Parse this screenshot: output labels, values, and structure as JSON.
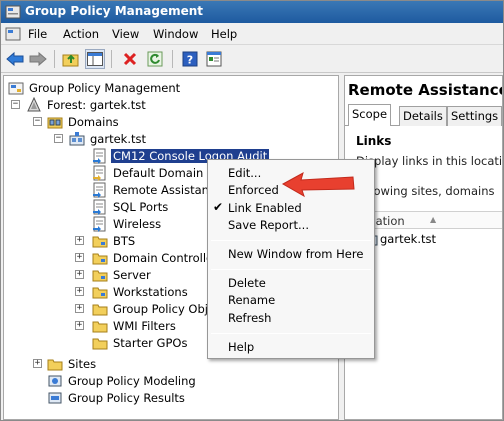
{
  "window": {
    "title": "Group Policy Management"
  },
  "menubar": {
    "items": [
      "File",
      "Action",
      "View",
      "Window",
      "Help"
    ]
  },
  "toolbar": {
    "buttons": [
      "back-icon",
      "forward-icon",
      "up-folder-icon",
      "show-hide-tree-icon",
      "delete-icon",
      "refresh-icon",
      "help-icon",
      "properties-icon"
    ]
  },
  "tree": {
    "root": "Group Policy Management",
    "forest": "Forest: gartek.tst",
    "domains": "Domains",
    "domain": "gartek.tst",
    "gpo_links": [
      "CM12 Console Logon Audit",
      "Default Domain Pol",
      "Remote Assistance",
      "SQL Ports",
      "Wireless"
    ],
    "ous": [
      "BTS",
      "Domain Controllers",
      "Server",
      "Workstations",
      "Group Policy Objec",
      "WMI Filters",
      "Starter GPOs"
    ],
    "sites": "Sites",
    "modeling": "Group Policy Modeling",
    "results": "Group Policy Results"
  },
  "right_pane": {
    "title": "Remote Assistance",
    "tabs": [
      "Scope",
      "Details",
      "Settings"
    ],
    "section": "Links",
    "desc": "Display links in this location:",
    "desc2": "following sites, domains",
    "column_header": "Location",
    "row": "gartek.tst"
  },
  "context_menu": {
    "items": [
      "Edit...",
      "Enforced",
      "Link Enabled",
      "Save Report...",
      "New Window from Here",
      "Delete",
      "Rename",
      "Refresh",
      "Help"
    ],
    "checked": "Link Enabled",
    "check_glyph": "✔"
  },
  "colors": {
    "selection": "#1f3f8f",
    "titlebar": "#1e5aa0",
    "annotation_arrow": "#e8402f"
  }
}
